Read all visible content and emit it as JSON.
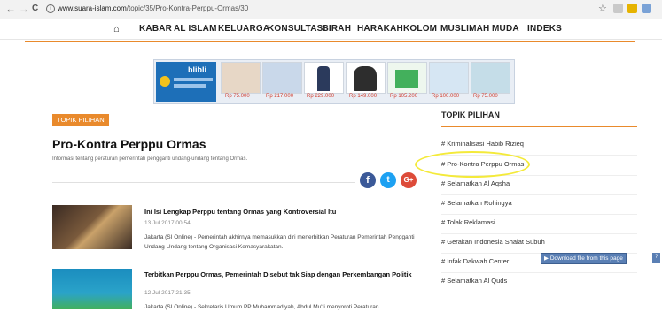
{
  "browser": {
    "back": "←",
    "forward": "→",
    "reload": "C",
    "url_host": "www.suara-islam.com",
    "url_path": "/topic/35/Pro-Kontra-Perppu-Ormas/30"
  },
  "nav": {
    "home_icon": "home-icon",
    "items": [
      "KABAR",
      "AL ISLAM",
      "KELUARGA",
      "KONSULTASI",
      "SIRAH",
      "HARAKAH",
      "KOLOM",
      "MUSLIMAH",
      "MUDA",
      "INDEKS"
    ]
  },
  "ad": {
    "brand": "blibli",
    "prices": [
      "Rp 75.000",
      "Rp 217.000",
      "Rp 229.000",
      "Rp 149.000",
      "Rp 105.200",
      "Rp 100.000",
      "Rp 75.000"
    ]
  },
  "main": {
    "badge": "TOPIK PILIHAN",
    "title": "Pro-Kontra Perppu Ormas",
    "description": "Informasi tentang peraturan pemerintah pengganti undang-undang tentang Ormas.",
    "social": {
      "facebook": "f",
      "twitter": "t",
      "google": "G+"
    },
    "articles": [
      {
        "title": "Ini Isi Lengkap Perppu tentang Ormas yang Kontroversial Itu",
        "date": "13 Jul 2017 00:54",
        "excerpt": "Jakarta (SI Online) - Pemerintah akhirnya memasukkan diri menerbitkan Peraturan Pemerintah Pengganti Undang-Undang tentang Organisasi Kemasyarakatan."
      },
      {
        "title": "Terbitkan Perppu Ormas, Pemerintah Disebut tak Siap dengan Perkembangan Politik",
        "date": "12 Jul 2017 21:35",
        "excerpt": "Jakarta (SI Online) - Sekretaris Umum PP Muhammadiyah, Abdul Mu'ti menyoroti Peraturan"
      }
    ]
  },
  "sidebar": {
    "title": "TOPIK PILIHAN",
    "items": [
      "# Kriminalisasi Habib Rizieq",
      "# Pro-Kontra Perppu Ormas",
      "# Selamatkan Al Aqsha",
      "# Selamatkan Rohingya",
      "# Tolak Reklamasi",
      "# Gerakan Indonesia Shalat Subuh",
      "# Infak Dakwah Center",
      "# Selamatkan Al Quds"
    ]
  },
  "download_bar": {
    "label": "Download file from this page",
    "help": "?"
  },
  "colors": {
    "accent": "#e98a2c",
    "facebook": "#3b5998",
    "twitter": "#1da1f2",
    "google": "#dd4b39",
    "highlight": "#f4ea3a"
  }
}
